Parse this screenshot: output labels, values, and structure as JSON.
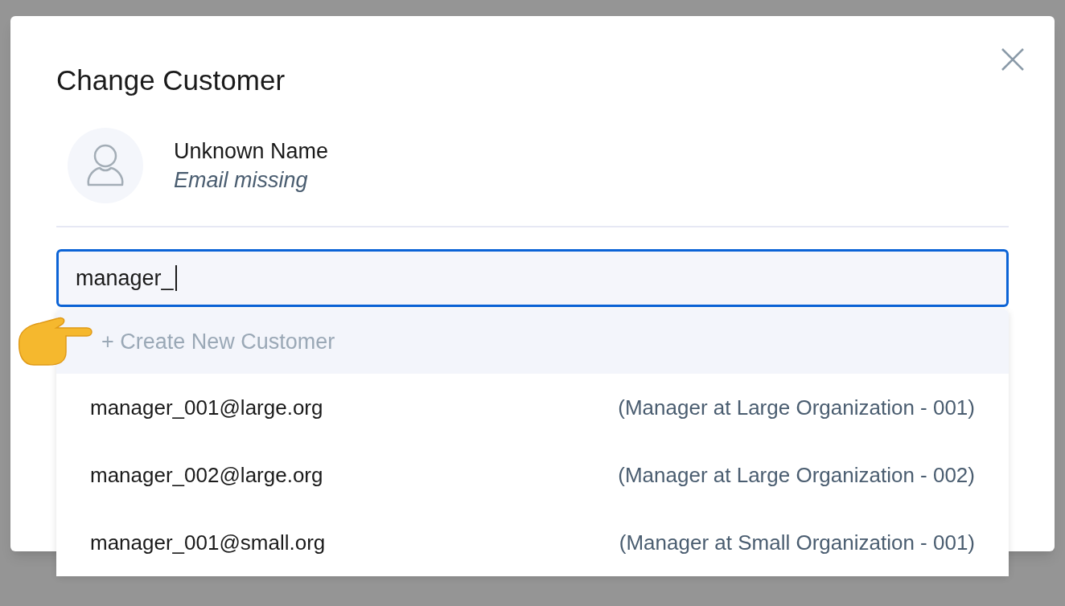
{
  "dialog": {
    "title": "Change Customer",
    "customer": {
      "name": "Unknown Name",
      "email": "Email missing"
    },
    "search": {
      "value": "manager_",
      "focused": true
    },
    "options": [
      {
        "kind": "create",
        "label": "+ Create New Customer",
        "selected": true
      },
      {
        "kind": "customer",
        "email": "manager_001@large.org",
        "description": "(Manager at Large Organization - 001)",
        "selected": false
      },
      {
        "kind": "customer",
        "email": "manager_002@large.org",
        "description": "(Manager at Large Organization - 002)",
        "selected": false
      },
      {
        "kind": "customer",
        "email": "manager_001@small.org",
        "description": "(Manager at Small Organization - 001)",
        "selected": false
      }
    ]
  }
}
